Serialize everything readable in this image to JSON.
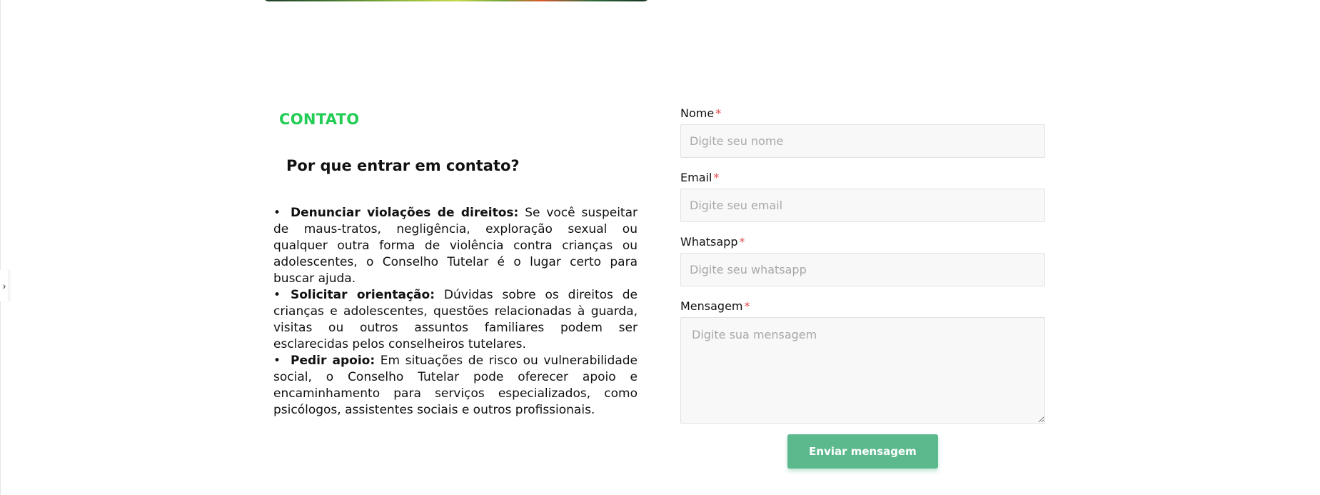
{
  "side_toggle": {
    "icon": "chevron-right-icon",
    "glyph": "›"
  },
  "contact": {
    "section_label": "CONTATO",
    "heading": "Por que entrar em contato?",
    "reasons": [
      {
        "title": "Denunciar violações de direitos:",
        "text": "Se você suspeitar de maus-tratos, negligência, exploração sexual ou qualquer outra forma de violência contra crianças ou adolescentes, o Conselho Tutelar é o lugar certo para buscar ajuda."
      },
      {
        "title": "Solicitar orientação:",
        "text": "Dúvidas sobre os direitos de crianças e adolescentes, questões relacionadas à guarda, visitas ou outros assuntos familiares podem ser esclarecidas pelos conselheiros tutelares."
      },
      {
        "title": "Pedir apoio:",
        "text": "Em situações de risco ou vulnerabilidade social, o Conselho Tutelar pode oferecer apoio e encaminhamento para serviços especializados, como psicólogos, assistentes sociais e outros profissionais."
      }
    ],
    "bullet": "•"
  },
  "form": {
    "required_mark": "*",
    "fields": {
      "name": {
        "label": "Nome",
        "placeholder": "Digite seu nome",
        "value": ""
      },
      "email": {
        "label": "Email",
        "placeholder": "Digite seu email",
        "value": ""
      },
      "whatsapp": {
        "label": "Whatsapp",
        "placeholder": "Digite seu whatsapp",
        "value": ""
      },
      "message": {
        "label": "Mensagem",
        "placeholder": "Digite sua mensagem",
        "value": ""
      }
    },
    "submit_label": "Enviar mensagem"
  },
  "colors": {
    "accent_green": "#22cc55",
    "button_green": "#5cb98e",
    "required_red": "#e24a4a"
  }
}
